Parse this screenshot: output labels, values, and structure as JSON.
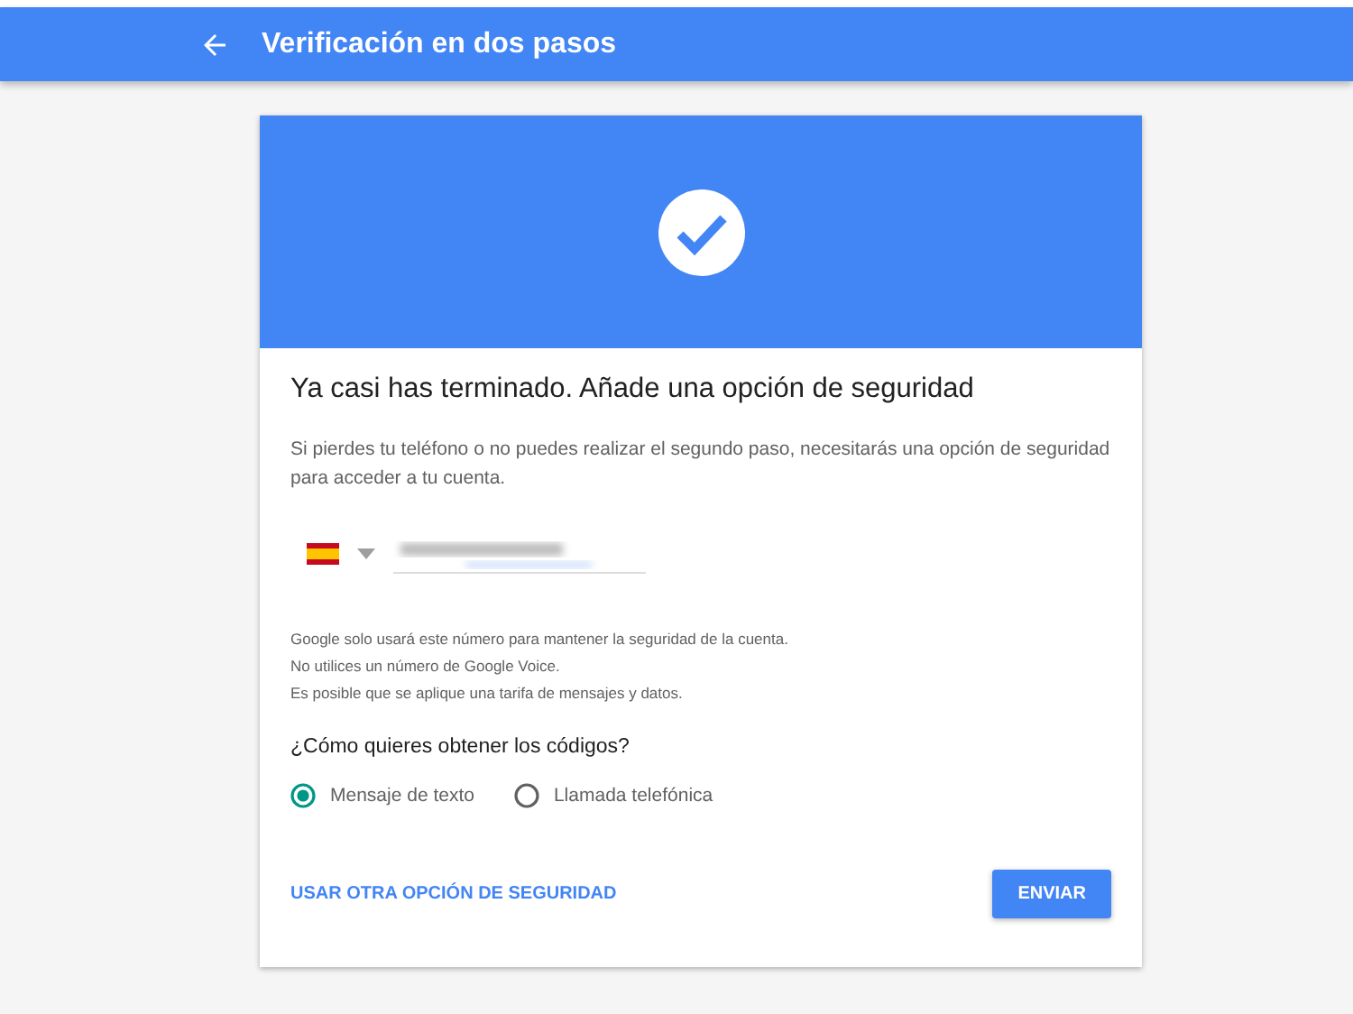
{
  "app_bar": {
    "title": "Verificación en dos pasos"
  },
  "card": {
    "heading": "Ya casi has terminado. Añade una opción de seguridad",
    "intro": "Si pierdes tu teléfono o no puedes realizar el segundo paso, necesitarás una opción de seguridad para acceder a tu cuenta.",
    "notes": [
      "Google solo usará este número para mantener la seguridad de la cuenta.",
      "No utilices un número de Google Voice.",
      "Es posible que se aplique una tarifa de mensajes y datos."
    ],
    "question": "¿Cómo quieres obtener los códigos?",
    "options": [
      {
        "label": "Mensaje de texto",
        "selected": true
      },
      {
        "label": "Llamada telefónica",
        "selected": false
      }
    ],
    "link": "USAR OTRA OPCIÓN DE SEGURIDAD",
    "button": "ENVIAR"
  }
}
